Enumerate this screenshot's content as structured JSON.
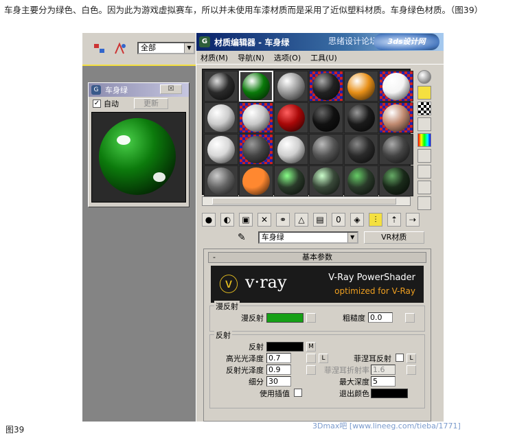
{
  "article": {
    "text": "车身主要分为绿色、白色。因为此为游戏虚拟赛车，所以并未使用车漆材质而是采用了近似塑料材质。车身绿色材质。（图39）",
    "caption": "图39",
    "watermark": "3Dmax吧 [www.lineeg.com/tieba/1771]"
  },
  "toolbar": {
    "filter_value": "全部"
  },
  "preview": {
    "title": "车身绿",
    "close_label": "☒",
    "auto_label": "自动",
    "auto_checked": "✓",
    "update_label": "更新"
  },
  "editor": {
    "title": "材质编辑器 - 车身绿",
    "title_watermark": "思绪设计论坛",
    "logo_text": "3ds设计网",
    "menu": [
      "材质(M)",
      "导航(N)",
      "选项(O)",
      "工具(U)"
    ],
    "material_name": "车身绿",
    "type_button": "VR材质",
    "slots": [
      {
        "color": "#2a2a2a",
        "hl": "#ddd",
        "checker": false
      },
      {
        "color": "#0a7a0a",
        "hl": "#fff",
        "checker": false,
        "selected": true
      },
      {
        "color": "#9a9a9a",
        "hl": "#fff",
        "checker": false
      },
      {
        "color": "#222",
        "hl": "#aaa",
        "checker": true
      },
      {
        "color": "#e89018",
        "hl": "#fff",
        "checker": false
      },
      {
        "color": "#f4f4f4",
        "hl": "#fff",
        "checker": true
      },
      {
        "color": "#ccc",
        "hl": "#fff",
        "checker": false
      },
      {
        "color": "#c8c8c8",
        "hl": "#fff",
        "checker": true
      },
      {
        "color": "#a80808",
        "hl": "#ff6060",
        "checker": false
      },
      {
        "color": "#111",
        "hl": "#666",
        "checker": false
      },
      {
        "color": "#1a1a1a",
        "hl": "#999",
        "checker": false
      },
      {
        "color": "#c08a70",
        "hl": "#fff",
        "checker": true
      },
      {
        "color": "#d8d8d8",
        "hl": "#fff",
        "checker": false
      },
      {
        "color": "#444",
        "hl": "#999",
        "checker": true
      },
      {
        "color": "#cfcfcf",
        "hl": "#fff",
        "checker": false
      },
      {
        "color": "#555",
        "hl": "#bbb",
        "checker": false
      },
      {
        "color": "#2a2a2a",
        "hl": "#888",
        "checker": false
      },
      {
        "color": "#444",
        "hl": "#aaa",
        "checker": false
      },
      {
        "color": "#666",
        "hl": "#ccc",
        "checker": false
      },
      {
        "color": "#ff8830",
        "hl": "#ff8830",
        "checker": false
      },
      {
        "color": "#2a3a2a",
        "hl": "#8f8",
        "checker": false
      },
      {
        "color": "#3a4a3a",
        "hl": "#cfc",
        "checker": false
      },
      {
        "color": "#2a3a2a",
        "hl": "#6c6",
        "checker": false
      },
      {
        "color": "#1a2a1a",
        "hl": "#6a6",
        "checker": false
      }
    ]
  },
  "params": {
    "rollout_title": "基本参数",
    "vray_logo": "v·ray",
    "vray_line1": "V-Ray PowerShader",
    "vray_line2": "optimized for V-Ray",
    "diffuse_group": "漫反射",
    "diffuse_label": "漫反射",
    "diffuse_color": "#16a016",
    "roughness_label": "粗糙度",
    "roughness_value": "0.0",
    "reflect_group": "反射",
    "reflect_label": "反射",
    "reflect_color": "#000000",
    "m_label": "M",
    "hilight_label": "高光光泽度",
    "hilight_value": "0.7",
    "l_label": "L",
    "fresnel_label": "菲涅耳反射",
    "refl_gloss_label": "反射光泽度",
    "refl_gloss_value": "0.9",
    "fresnel_ior_label": "菲涅耳折射率",
    "fresnel_ior_value": "1.6",
    "subdivs_label": "细分",
    "subdivs_value": "30",
    "max_depth_label": "最大深度",
    "max_depth_value": "5",
    "interp_label": "使用插值",
    "exit_color_label": "退出颜色",
    "exit_color": "#000000"
  }
}
